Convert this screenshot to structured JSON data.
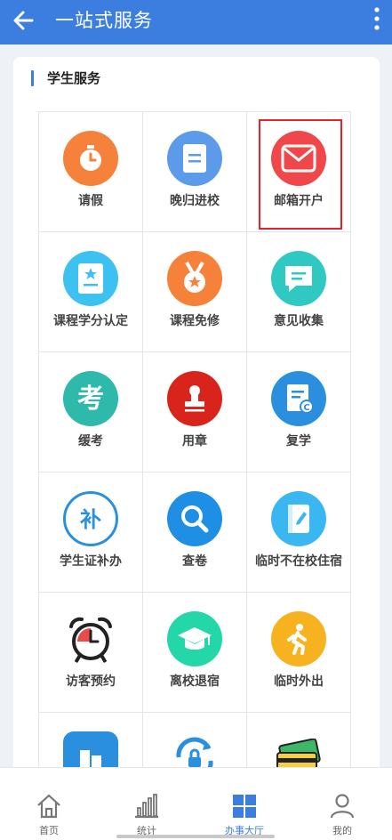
{
  "header": {
    "title": "一站式服务",
    "back_icon": "arrow-left-icon",
    "more_icon": "more-vertical-icon"
  },
  "section": {
    "title": "学生服务"
  },
  "services": [
    {
      "label": "请假",
      "icon": "clock-icon",
      "color": "#f5813a"
    },
    {
      "label": "晚归进校",
      "icon": "document-icon",
      "color": "#5b9bea"
    },
    {
      "label": "邮箱开户",
      "icon": "mail-icon",
      "color": "#f0484a",
      "highlighted": true
    },
    {
      "label": "课程学分认定",
      "icon": "certificate-icon",
      "color": "#3cc1f0"
    },
    {
      "label": "课程免修",
      "icon": "medal-icon",
      "color": "#f5813a"
    },
    {
      "label": "意见收集",
      "icon": "message-icon",
      "color": "#2fc9c1"
    },
    {
      "label": "缓考",
      "icon": "exam-icon",
      "color": "#2fb9ab"
    },
    {
      "label": "用章",
      "icon": "stamp-icon",
      "color": "#d9241b"
    },
    {
      "label": "复学",
      "icon": "file-icon",
      "color": "#2b8fe0"
    },
    {
      "label": "学生证补办",
      "icon": "reissue-icon",
      "color": "#2b8fe0"
    },
    {
      "label": "查卷",
      "icon": "search-icon",
      "color": "#1f8fe5"
    },
    {
      "label": "临时不在校住宿",
      "icon": "notebook-icon",
      "color": "#3ab7f0"
    },
    {
      "label": "访客预约",
      "icon": "alarm-clock-icon",
      "color": "#e94b4b"
    },
    {
      "label": "离校退宿",
      "icon": "graduation-cap-icon",
      "color": "#23d7a8"
    },
    {
      "label": "临时外出",
      "icon": "walking-icon",
      "color": "#f7b21f"
    },
    {
      "label": "",
      "icon": "building-icon",
      "color": "#2b8fe0"
    },
    {
      "label": "",
      "icon": "lock-sync-icon",
      "color": "#2b8fe0"
    },
    {
      "label": "",
      "icon": "cards-icon",
      "color": "#3cb868"
    }
  ],
  "nav": [
    {
      "label": "首页",
      "icon": "home-icon"
    },
    {
      "label": "统计",
      "icon": "bar-chart-icon"
    },
    {
      "label": "办事大厅",
      "icon": "grid-icon",
      "active": true
    },
    {
      "label": "我的",
      "icon": "user-icon"
    }
  ],
  "colors": {
    "primary": "#3c7ee0",
    "highlight": "#e8202a"
  }
}
